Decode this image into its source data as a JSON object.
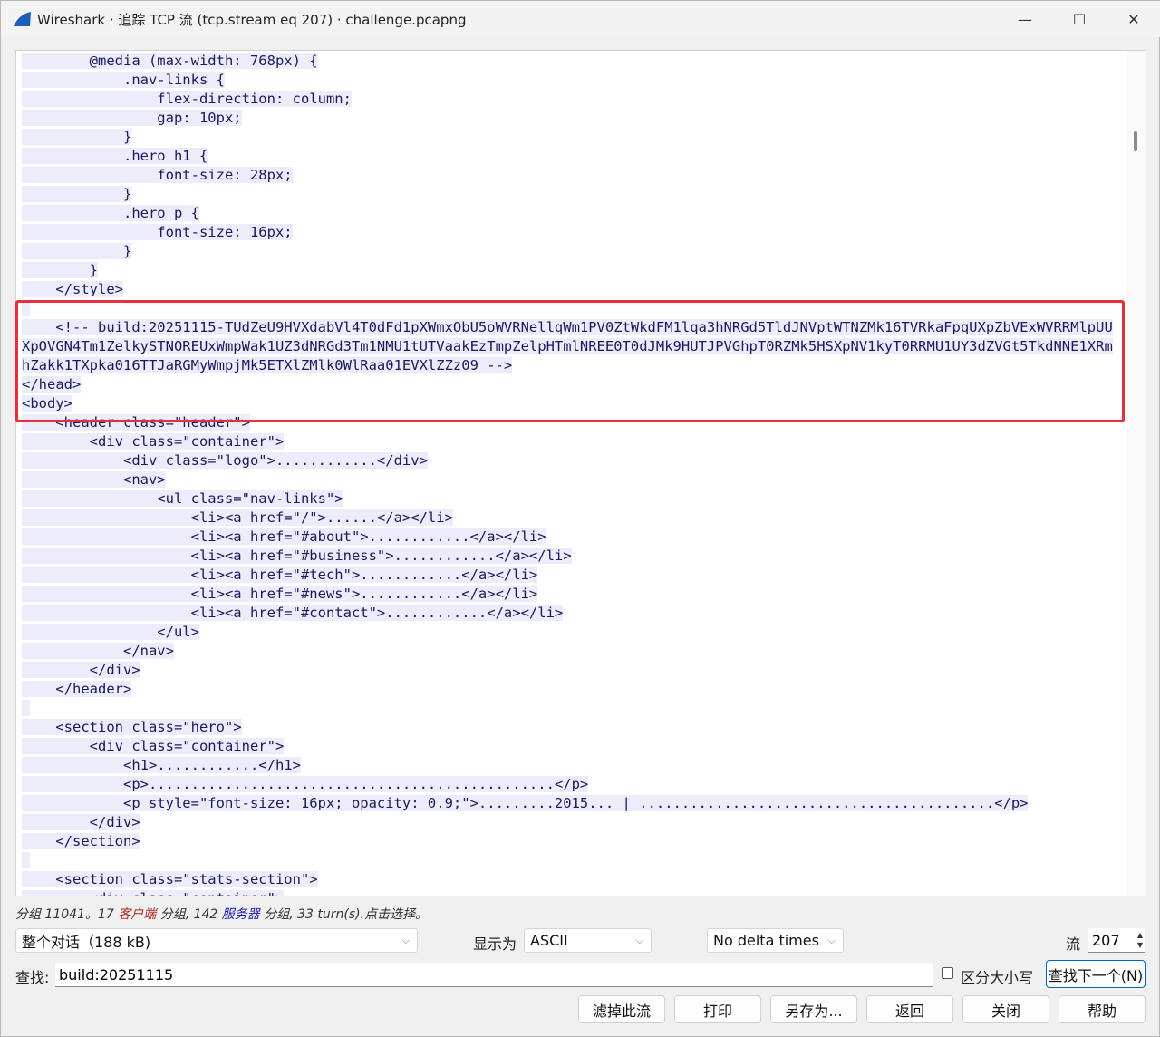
{
  "window": {
    "title": "Wireshark · 追踪 TCP 流 (tcp.stream eq 207) · challenge.pcapng",
    "minimize": "—",
    "maximize": "☐",
    "close": "✕"
  },
  "stream_lines": [
    "        @media (max-width: 768px) {",
    "            .nav-links {",
    "                flex-direction: column;",
    "                gap: 10px;",
    "            }",
    "            .hero h1 {",
    "                font-size: 28px;",
    "            }",
    "            .hero p {",
    "                font-size: 16px;",
    "            }",
    "        }",
    "    </style>",
    "",
    "    <!-- build:20251115-TUdZeU9HVXdabVl4T0dFd1pXWmxObU5oWVRNellqWm1PV0ZtWkdFM1lqa3hNRGd5TldJNVptWTNZMk16TVRkaFpqUXpZbVExWVRRMlpUU",
    "XpOVGN4Tm1ZelkySTNOREUxWmpWak1UZ3dNRGd3Tm1NMU1tUTVaakEzTmpZelpHTmlNREE0T0dJMk9HUTJPVGhpT0RZMk5HSXpNV1kyT0RRMU1UY3dZVGt5TkdNNE1XRm",
    "hZakk1TXpka016TTJaRGMyWmpjMk5ETXlZMlk0WlRaa01EVXlZZz09 -->",
    "</head>",
    "<body>",
    "    <header class=\"header\">",
    "        <div class=\"container\">",
    "            <div class=\"logo\">............</div>",
    "            <nav>",
    "                <ul class=\"nav-links\">",
    "                    <li><a href=\"/\">......</a></li>",
    "                    <li><a href=\"#about\">............</a></li>",
    "                    <li><a href=\"#business\">............</a></li>",
    "                    <li><a href=\"#tech\">............</a></li>",
    "                    <li><a href=\"#news\">............</a></li>",
    "                    <li><a href=\"#contact\">............</a></li>",
    "                </ul>",
    "            </nav>",
    "        </div>",
    "    </header>",
    "",
    "    <section class=\"hero\">",
    "        <div class=\"container\">",
    "            <h1>............</h1>",
    "            <p>................................................</p>",
    "            <p style=\"font-size: 16px; opacity: 0.9;\">.........2015... | ..........................................</p>",
    "        </div>",
    "    </section>",
    "",
    "    <section class=\"stats-section\">",
    "        <div class=\"container\">"
  ],
  "status": {
    "prefix": "分组 11041。17 ",
    "client": "客户端",
    "mid": " 分组, 142 ",
    "server": "服务器",
    "suffix": " 分组, 33 turn(s).点击选择。"
  },
  "controls": {
    "conversation": "整个对话（188 kB)",
    "show_as_label": "显示为",
    "show_as": "ASCII",
    "delta": "No delta times",
    "stream_label": "流",
    "stream_value": "207",
    "find_label": "查找:",
    "find_value": "build:20251115",
    "case_label": "区分大小写",
    "find_next": "查找下一个(N)"
  },
  "buttons": [
    "滤掉此流",
    "打印",
    "另存为...",
    "返回",
    "关闭",
    "帮助"
  ],
  "colors": {
    "client_text": "#1a1a5e",
    "client_bg": "#ececfa",
    "highlight_box": "#e8303a"
  }
}
